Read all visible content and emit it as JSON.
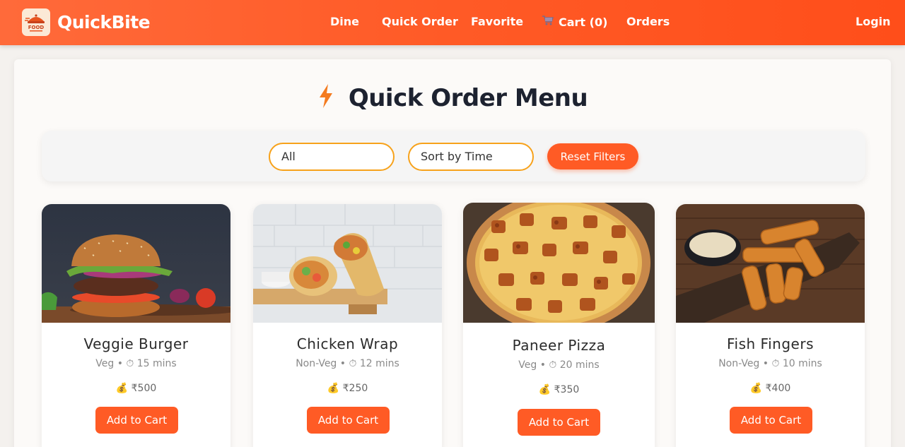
{
  "navbar": {
    "brand": "QuickBite",
    "logo_text": "FOOD",
    "links": {
      "dine": "Dine",
      "quick_order": "Quick Order",
      "favorite": "Favorite",
      "cart": "Cart (0)",
      "orders": "Orders",
      "login": "Login"
    }
  },
  "page": {
    "title": "Quick Order Menu",
    "title_icon": "lightning-icon"
  },
  "filters": {
    "category_value": "All",
    "sort_value": "Sort by Time",
    "reset_label": "Reset Filters"
  },
  "menu": [
    {
      "name": "Veggie Burger",
      "meta": "Veg • ⏱ 15 mins",
      "price": "₹500",
      "button": "Add to Cart"
    },
    {
      "name": "Chicken Wrap",
      "meta": "Non-Veg • ⏱ 12 mins",
      "price": "₹250",
      "button": "Add to Cart"
    },
    {
      "name": "Paneer Pizza",
      "meta": "Veg • ⏱ 20 mins",
      "price": "₹350",
      "button": "Add to Cart"
    },
    {
      "name": "Fish Fingers",
      "meta": "Non-Veg • ⏱ 10 mins",
      "price": "₹400",
      "button": "Add to Cart"
    }
  ],
  "colors": {
    "accent": "#ff5b25",
    "select_border": "#f7a21b",
    "title": "#1d2230",
    "lightning": "#f47b20"
  }
}
